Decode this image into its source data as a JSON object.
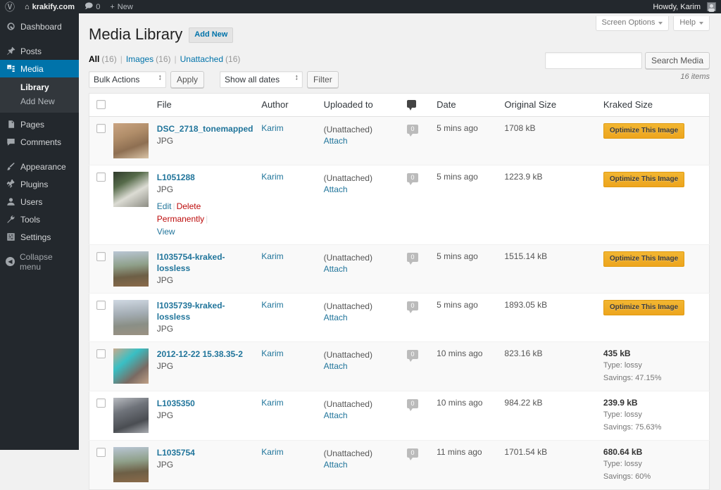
{
  "adminbar": {
    "wp_logo": "wordpress-logo-icon",
    "site_name": "krakify.com",
    "comments_count": "0",
    "new_label": "New",
    "howdy": "Howdy, Karim"
  },
  "sidebar": {
    "items": [
      {
        "label": "Dashboard",
        "icon": "dashboard-icon",
        "current": false
      },
      {
        "label": "Posts",
        "icon": "pin-icon",
        "current": false
      },
      {
        "label": "Media",
        "icon": "media-icon",
        "current": true
      },
      {
        "label": "Pages",
        "icon": "pages-icon",
        "current": false
      },
      {
        "label": "Comments",
        "icon": "comments-icon",
        "current": false
      },
      {
        "label": "Appearance",
        "icon": "appearance-brush-icon",
        "current": false
      },
      {
        "label": "Plugins",
        "icon": "plugins-plug-icon",
        "current": false
      },
      {
        "label": "Users",
        "icon": "users-icon",
        "current": false
      },
      {
        "label": "Tools",
        "icon": "tools-wrench-icon",
        "current": false
      },
      {
        "label": "Settings",
        "icon": "settings-sliders-icon",
        "current": false
      }
    ],
    "submenu": [
      {
        "label": "Library",
        "current": true
      },
      {
        "label": "Add New",
        "current": false
      }
    ],
    "collapse_label": "Collapse menu"
  },
  "screen_meta": {
    "screen_options": "Screen Options",
    "help": "Help"
  },
  "header": {
    "title": "Media Library",
    "add_new": "Add New"
  },
  "filters": {
    "all_label": "All",
    "all_count": "(16)",
    "images_label": "Images",
    "images_count": "(16)",
    "unattached_label": "Unattached",
    "unattached_count": "(16)"
  },
  "search": {
    "value": "",
    "placeholder": "",
    "button": "Search Media"
  },
  "tablenav": {
    "bulk_actions": "Bulk Actions",
    "apply": "Apply",
    "show_all_dates": "Show all dates",
    "filter": "Filter",
    "items_count": "16 items"
  },
  "table": {
    "columns": {
      "file": "File",
      "author": "Author",
      "uploaded_to": "Uploaded to",
      "comments": "comments-icon",
      "date": "Date",
      "original_size": "Original Size",
      "kraked_size": "Kraked Size"
    },
    "rows": [
      {
        "file": "DSC_2718_tonemapped",
        "ext": "JPG",
        "author": "Karim",
        "uploaded_to": "(Unattached)",
        "attach": "Attach",
        "comments": "0",
        "date": "5 mins ago",
        "original_size": "1708 kB",
        "kraked": {
          "state": "unoptimized",
          "button": "Optimize This Image"
        },
        "actions": null,
        "thumb": "alley-street-photo"
      },
      {
        "file": "L1051288",
        "ext": "JPG",
        "author": "Karim",
        "uploaded_to": "(Unattached)",
        "attach": "Attach",
        "comments": "0",
        "date": "5 mins ago",
        "original_size": "1223.9 kB",
        "kraked": {
          "state": "unoptimized",
          "button": "Optimize This Image"
        },
        "actions": {
          "edit": "Edit",
          "delete": "Delete Permanently",
          "view": "View"
        },
        "thumb": "geese-bicycle-photo"
      },
      {
        "file": "l1035754-kraked-lossless",
        "ext": "JPG",
        "author": "Karim",
        "uploaded_to": "(Unattached)",
        "attach": "Attach",
        "comments": "0",
        "date": "5 mins ago",
        "original_size": "1515.14 kB",
        "kraked": {
          "state": "unoptimized",
          "button": "Optimize This Image"
        },
        "actions": null,
        "thumb": "forest-sunbeam-photo"
      },
      {
        "file": "l1035739-kraked-lossless",
        "ext": "JPG",
        "author": "Karim",
        "uploaded_to": "(Unattached)",
        "attach": "Attach",
        "comments": "0",
        "date": "5 mins ago",
        "original_size": "1893.05 kB",
        "kraked": {
          "state": "unoptimized",
          "button": "Optimize This Image"
        },
        "actions": null,
        "thumb": "forest-trees-photo"
      },
      {
        "file": "2012-12-22 15.38.35-2",
        "ext": "JPG",
        "author": "Karim",
        "uploaded_to": "(Unattached)",
        "attach": "Attach",
        "comments": "0",
        "date": "10 mins ago",
        "original_size": "823.16 kB",
        "kraked": {
          "state": "optimized",
          "size": "435 kB",
          "type": "Type: lossy",
          "savings": "Savings: 47.15%"
        },
        "actions": null,
        "thumb": "interior-teal-photo"
      },
      {
        "file": "L1035350",
        "ext": "JPG",
        "author": "Karim",
        "uploaded_to": "(Unattached)",
        "attach": "Attach",
        "comments": "0",
        "date": "10 mins ago",
        "original_size": "984.22 kB",
        "kraked": {
          "state": "optimized",
          "size": "239.9 kB",
          "type": "Type: lossy",
          "savings": "Savings: 75.63%"
        },
        "actions": null,
        "thumb": "pigeons-square-photo"
      },
      {
        "file": "L1035754",
        "ext": "JPG",
        "author": "Karim",
        "uploaded_to": "(Unattached)",
        "attach": "Attach",
        "comments": "0",
        "date": "11 mins ago",
        "original_size": "1701.54 kB",
        "kraked": {
          "state": "optimized",
          "size": "680.64 kB",
          "type": "Type: lossy",
          "savings": "Savings: 60%"
        },
        "actions": null,
        "thumb": "forest-sunbeam-photo"
      }
    ]
  },
  "colors": {
    "admin_dark": "#23282d",
    "accent_blue": "#0073aa",
    "link_blue": "#21759b",
    "optimize_amber": "#eda51e",
    "delete_red": "#bc0b0b"
  }
}
